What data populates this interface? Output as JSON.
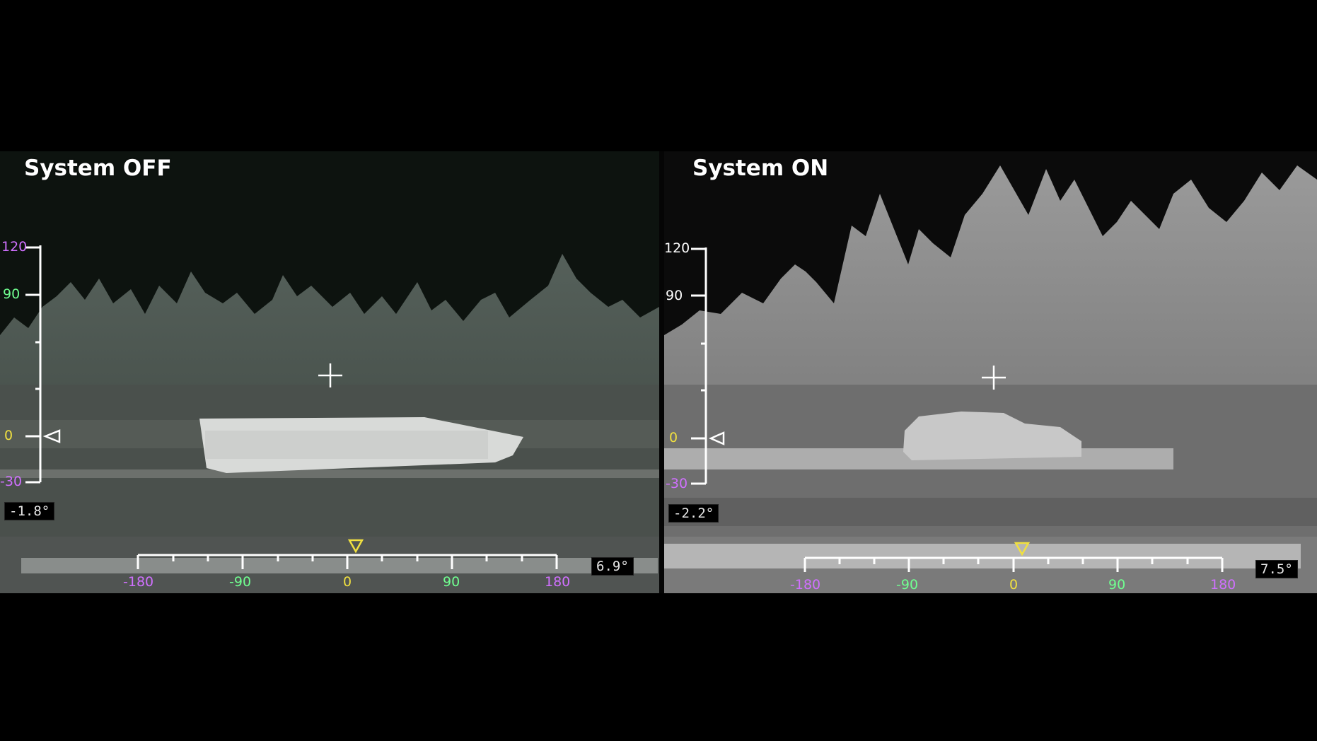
{
  "panels": {
    "off": {
      "title": "System OFF",
      "elevation_scale": [
        "120",
        "90",
        "0",
        "-30"
      ],
      "azimuth_scale": [
        "-180",
        "-90",
        "0",
        "90",
        "180"
      ],
      "elevation_readout": "-1.8°",
      "azimuth_readout": "6.9°"
    },
    "on": {
      "title": "System ON",
      "elevation_scale": [
        "120",
        "90",
        "0",
        "-30"
      ],
      "azimuth_scale": [
        "-180",
        "-90",
        "0",
        "90",
        "180"
      ],
      "elevation_readout": "-2.2°",
      "azimuth_readout": "7.5°"
    }
  },
  "colors": {
    "background": "#000000",
    "hud_white": "#ffffff",
    "tick_magenta": "#d070ff",
    "tick_green": "#70ff90",
    "marker_yellow": "#f0e040"
  },
  "icons": [
    "crosshair-icon",
    "elevation-pointer-icon",
    "azimuth-pointer-icon"
  ]
}
